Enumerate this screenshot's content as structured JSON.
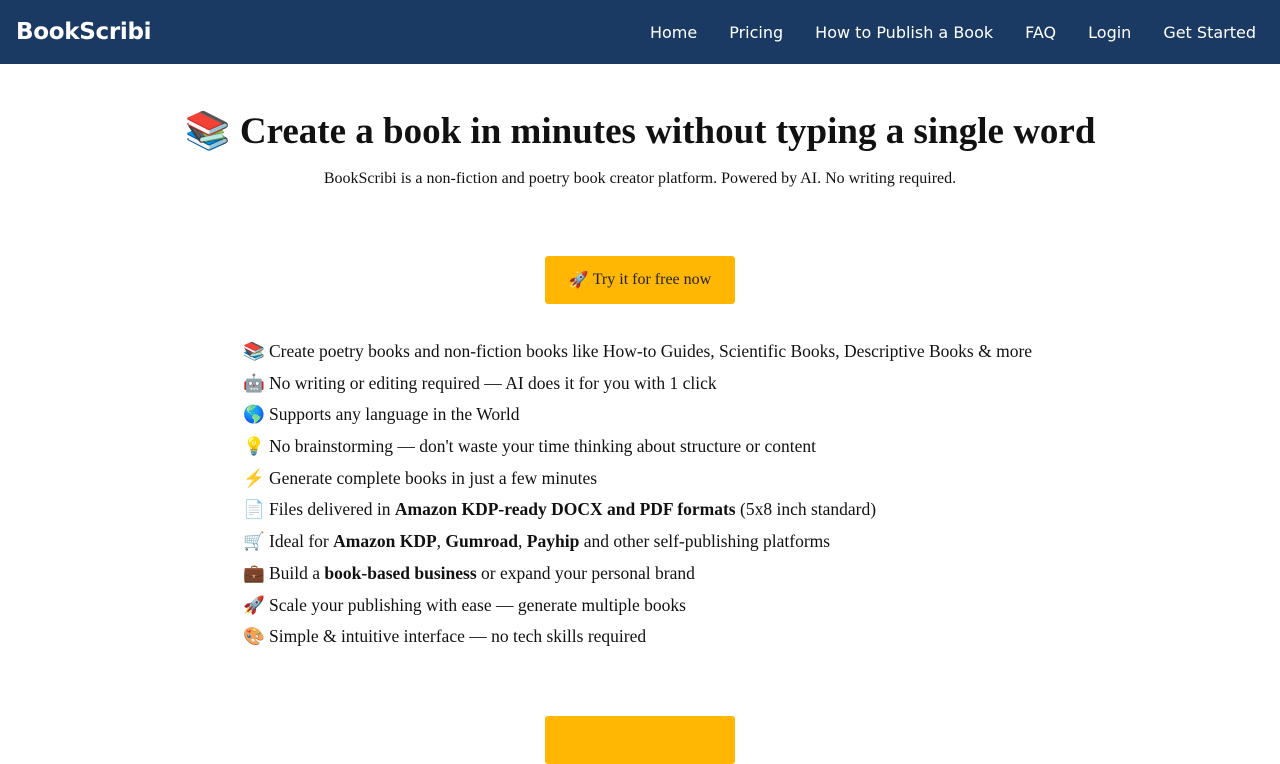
{
  "navbar": {
    "brand": "BookScribi",
    "links": [
      "Home",
      "Pricing",
      "How to Publish a Book",
      "FAQ",
      "Login",
      "Get Started"
    ]
  },
  "hero": {
    "title_icon": "📚",
    "title": "Create a book in minutes without typing a single word",
    "subtitle": "BookScribi is a non-fiction and poetry book creator platform. Powered by AI. No writing required.",
    "cta_icon": "🚀",
    "cta_label": "Try it for free now"
  },
  "features": [
    {
      "icon": "📚",
      "parts": [
        [
          "t",
          "Create poetry books and non-fiction books like How-to Guides, Scientific Books, Descriptive Books & more"
        ]
      ]
    },
    {
      "icon": "🤖",
      "parts": [
        [
          "t",
          "No writing or editing required — AI does it for you with 1 click"
        ]
      ]
    },
    {
      "icon": "🌎",
      "parts": [
        [
          "t",
          "Supports any language in the World"
        ]
      ]
    },
    {
      "icon": "💡",
      "parts": [
        [
          "t",
          "No brainstorming — don't waste your time thinking about structure or content"
        ]
      ]
    },
    {
      "icon": "⚡",
      "parts": [
        [
          "t",
          "Generate complete books in just a few minutes"
        ]
      ]
    },
    {
      "icon": "📄",
      "parts": [
        [
          "t",
          "Files delivered in "
        ],
        [
          "b",
          "Amazon KDP-ready DOCX and PDF formats"
        ],
        [
          "t",
          " (5x8 inch standard)"
        ]
      ]
    },
    {
      "icon": "🛒",
      "parts": [
        [
          "t",
          "Ideal for "
        ],
        [
          "b",
          "Amazon KDP"
        ],
        [
          "t",
          ", "
        ],
        [
          "b",
          "Gumroad"
        ],
        [
          "t",
          ", "
        ],
        [
          "b",
          "Payhip"
        ],
        [
          "t",
          " and other self-publishing platforms"
        ]
      ]
    },
    {
      "icon": "💼",
      "parts": [
        [
          "t",
          "Build a "
        ],
        [
          "b",
          "book-based business"
        ],
        [
          "t",
          " or expand your personal brand"
        ]
      ]
    },
    {
      "icon": "🚀",
      "parts": [
        [
          "t",
          "Scale your publishing with ease — generate multiple books"
        ]
      ]
    },
    {
      "icon": "🎨",
      "parts": [
        [
          "t",
          "Simple & intuitive interface — no tech skills required"
        ]
      ]
    }
  ],
  "colors": {
    "navbar_bg": "#1a3a63",
    "cta_bg": "#ffb703"
  }
}
